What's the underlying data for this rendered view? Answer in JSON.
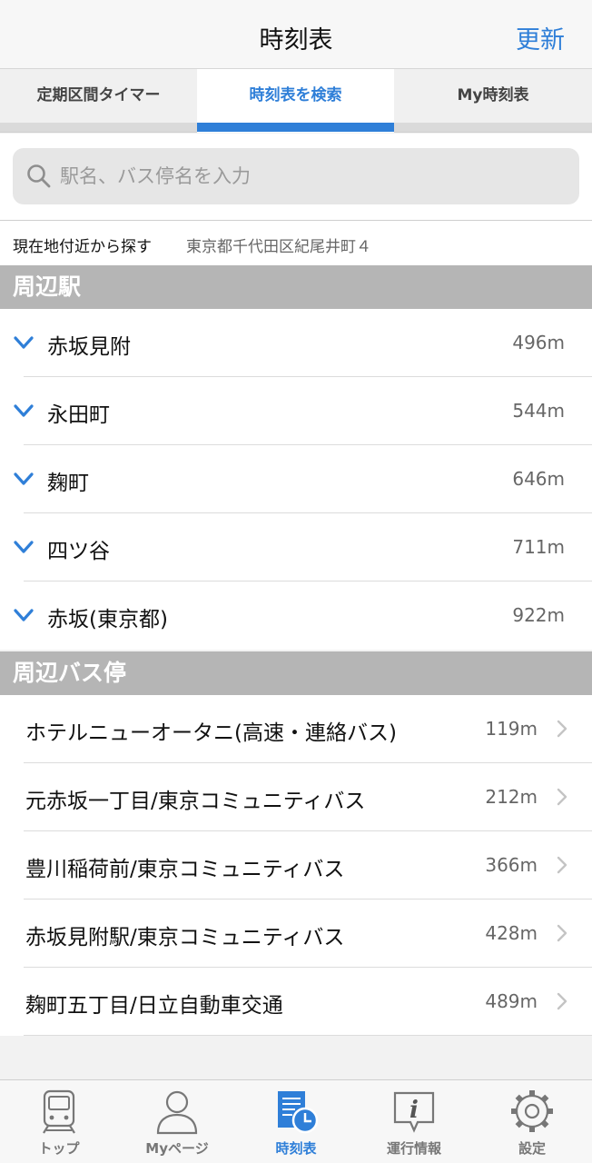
{
  "nav": {
    "title": "時刻表",
    "update_label": "更新"
  },
  "segments": {
    "items": [
      {
        "label": "定期区間タイマー"
      },
      {
        "label": "時刻表を検索"
      },
      {
        "label": "My時刻表"
      }
    ],
    "selected": "時刻表を検索"
  },
  "search": {
    "placeholder": "駅名、バス停名を入力",
    "value": ""
  },
  "location": {
    "label": "現在地付近から探す",
    "address": "東京都千代田区紀尾井町４"
  },
  "stations": {
    "header": "周辺駅",
    "items": [
      {
        "name": "赤坂見附",
        "distance": "496m"
      },
      {
        "name": "永田町",
        "distance": "544m"
      },
      {
        "name": "麹町",
        "distance": "646m"
      },
      {
        "name": "四ツ谷",
        "distance": "711m"
      },
      {
        "name": "赤坂(東京都)",
        "distance": "922m"
      }
    ]
  },
  "bus_stops": {
    "header": "周辺バス停",
    "items": [
      {
        "name": "ホテルニューオータニ(高速・連絡バス)",
        "distance": "119m"
      },
      {
        "name": "元赤坂一丁目/東京コミュニティバス",
        "distance": "212m"
      },
      {
        "name": "豊川稲荷前/東京コミュニティバス",
        "distance": "366m"
      },
      {
        "name": "赤坂見附駅/東京コミュニティバス",
        "distance": "428m"
      },
      {
        "name": "麹町五丁目/日立自動車交通",
        "distance": "489m"
      }
    ]
  },
  "tabbar": {
    "items": [
      {
        "label": "トップ",
        "icon": "train-icon"
      },
      {
        "label": "Myページ",
        "icon": "person-icon"
      },
      {
        "label": "時刻表",
        "icon": "timetable-icon"
      },
      {
        "label": "運行情報",
        "icon": "info-icon"
      },
      {
        "label": "設定",
        "icon": "gear-icon"
      }
    ],
    "active": "時刻表"
  },
  "colors": {
    "accent": "#2f7fd8",
    "section_header": "#b5b5b5",
    "inactive_icon": "#777777"
  }
}
